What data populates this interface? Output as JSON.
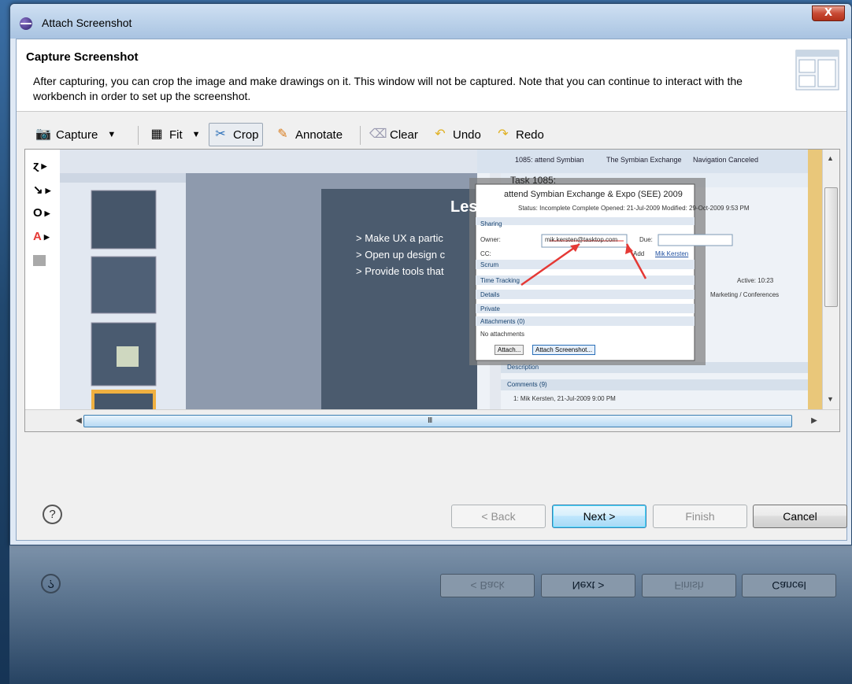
{
  "window": {
    "title": "Attach Screenshot",
    "close_glyph": "X"
  },
  "header": {
    "title": "Capture Screenshot",
    "description": "After capturing, you can crop the image and make drawings on it. This window will not be captured. Note that you can continue to interact with the workbench in order to set up the screenshot."
  },
  "toolbar": {
    "capture": "Capture",
    "fit": "Fit",
    "crop": "Crop",
    "annotate": "Annotate",
    "clear": "Clear",
    "undo": "Undo",
    "redo": "Redo",
    "icons": [
      "camera-icon",
      "fit-icon",
      "crop-icon",
      "pencil-icon",
      "eraser-icon",
      "undo-icon",
      "redo-icon"
    ]
  },
  "palette": [
    "free-line-tool",
    "arrow-tool",
    "rectangle-tool",
    "text-tool",
    "color-swatch"
  ],
  "captured": {
    "slide_heading": "Les",
    "bullets": [
      "> Make UX a partic",
      "> Open up design c",
      "> Provide tools that"
    ],
    "task_tab": "1085: attend Symbian",
    "exchange_tab": "The Symbian Exchange",
    "nav_tab": "Navigation Canceled",
    "task_id": "Task 1085:",
    "task_title": "attend Symbian Exchange & Expo (SEE) 2009",
    "status_line": "Status: Incomplete  Complete  Opened: 21-Jul-2009  Modified: 29-Oct-2009 9:53 PM",
    "sections": [
      "Sharing",
      "Scrum",
      "Time Tracking",
      "Details",
      "Private",
      "Attachments (0)"
    ],
    "owner_label": "Owner:",
    "owner_value": "mik.kersten@tasktop.com",
    "due_label": "Due:",
    "cc_label": "CC:",
    "add_label": "Add",
    "cc_user": "Mik Kersten",
    "active": "Active: 10:23",
    "category": "Marketing / Conferences",
    "no_attachments": "No attachments",
    "attach_btn": "Attach...",
    "attach_screenshot_btn": "Attach Screenshot...",
    "description_label": "Description",
    "comments_label": "Comments (9)",
    "comment_1": "1: Mik Kersten, 21-Jul-2009 9:00 PM"
  },
  "scrollbar": {
    "grip": "III"
  },
  "buttons": {
    "help": "?",
    "back": "< Back",
    "next": "Next >",
    "finish": "Finish",
    "cancel": "Cancel"
  },
  "colors": {
    "accent": "#3c7fb1",
    "annotation_red": "#e53935",
    "close_red": "#c84a34"
  }
}
